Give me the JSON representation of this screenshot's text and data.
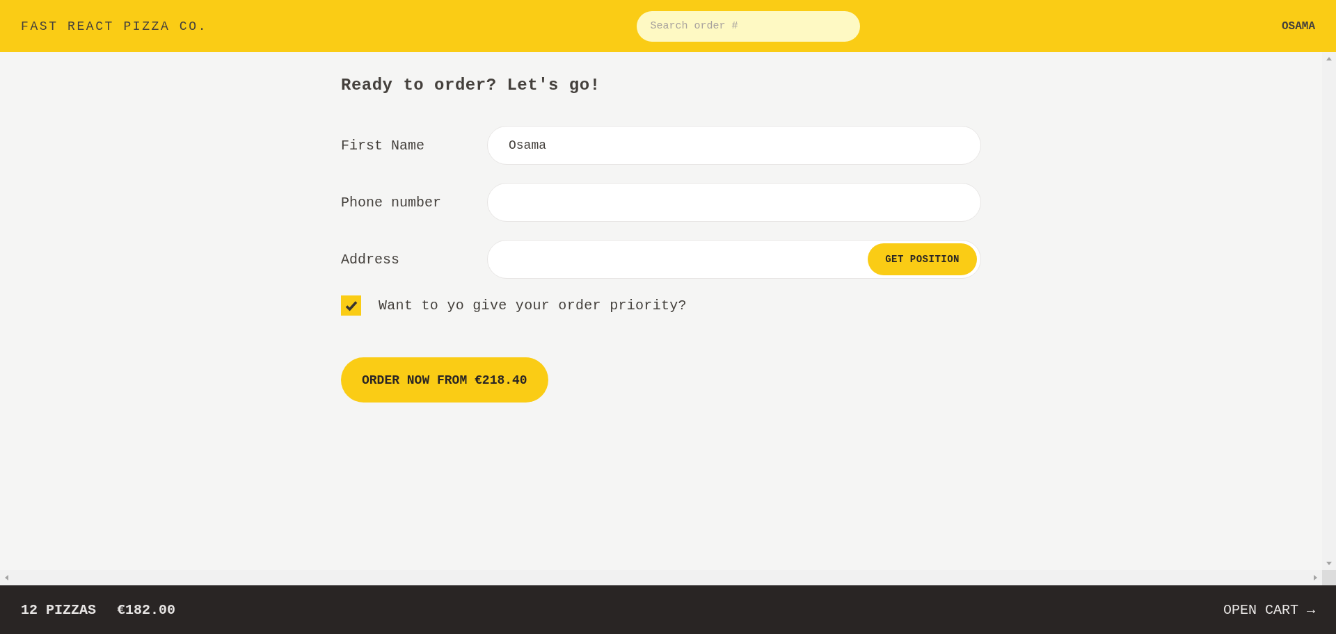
{
  "header": {
    "logo": "FAST REACT PIZZA CO.",
    "search": {
      "placeholder": "Search order #"
    },
    "user": "OSAMA"
  },
  "form": {
    "title": "Ready to order? Let's go!",
    "fields": [
      {
        "kind": "text",
        "label": "First Name",
        "value": "Osama"
      },
      {
        "kind": "text",
        "label": "Phone number"
      },
      {
        "kind": "with-button",
        "label": "Address",
        "button": "GET POSITION"
      }
    ],
    "priority": {
      "label": "Want to yo give your order priority?",
      "checked": true
    },
    "submit": "ORDER NOW FROM €218.40"
  },
  "cart_bar": {
    "count": "12 PIZZAS",
    "total": "€182.00",
    "link": "OPEN CART →"
  }
}
